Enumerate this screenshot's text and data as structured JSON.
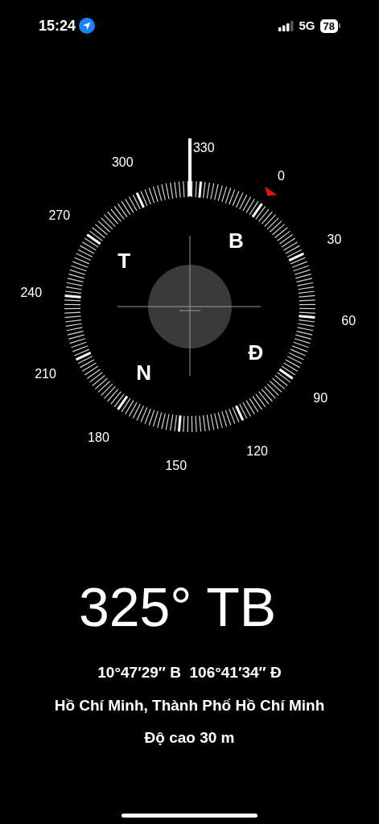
{
  "status_bar": {
    "time": "15:24",
    "network": "5G",
    "battery": "78"
  },
  "compass": {
    "degree_labels": [
      "0",
      "30",
      "60",
      "90",
      "120",
      "150",
      "180",
      "210",
      "240",
      "270",
      "300",
      "330"
    ],
    "cardinals": [
      "B",
      "Đ",
      "N",
      "T"
    ]
  },
  "heading": "325° TB",
  "coordinates": "10°47′29″ B  106°41′34″ Đ",
  "location": "Hồ Chí Minh, Thành Phố Hồ Chí Minh",
  "altitude": "Độ cao 30 m"
}
